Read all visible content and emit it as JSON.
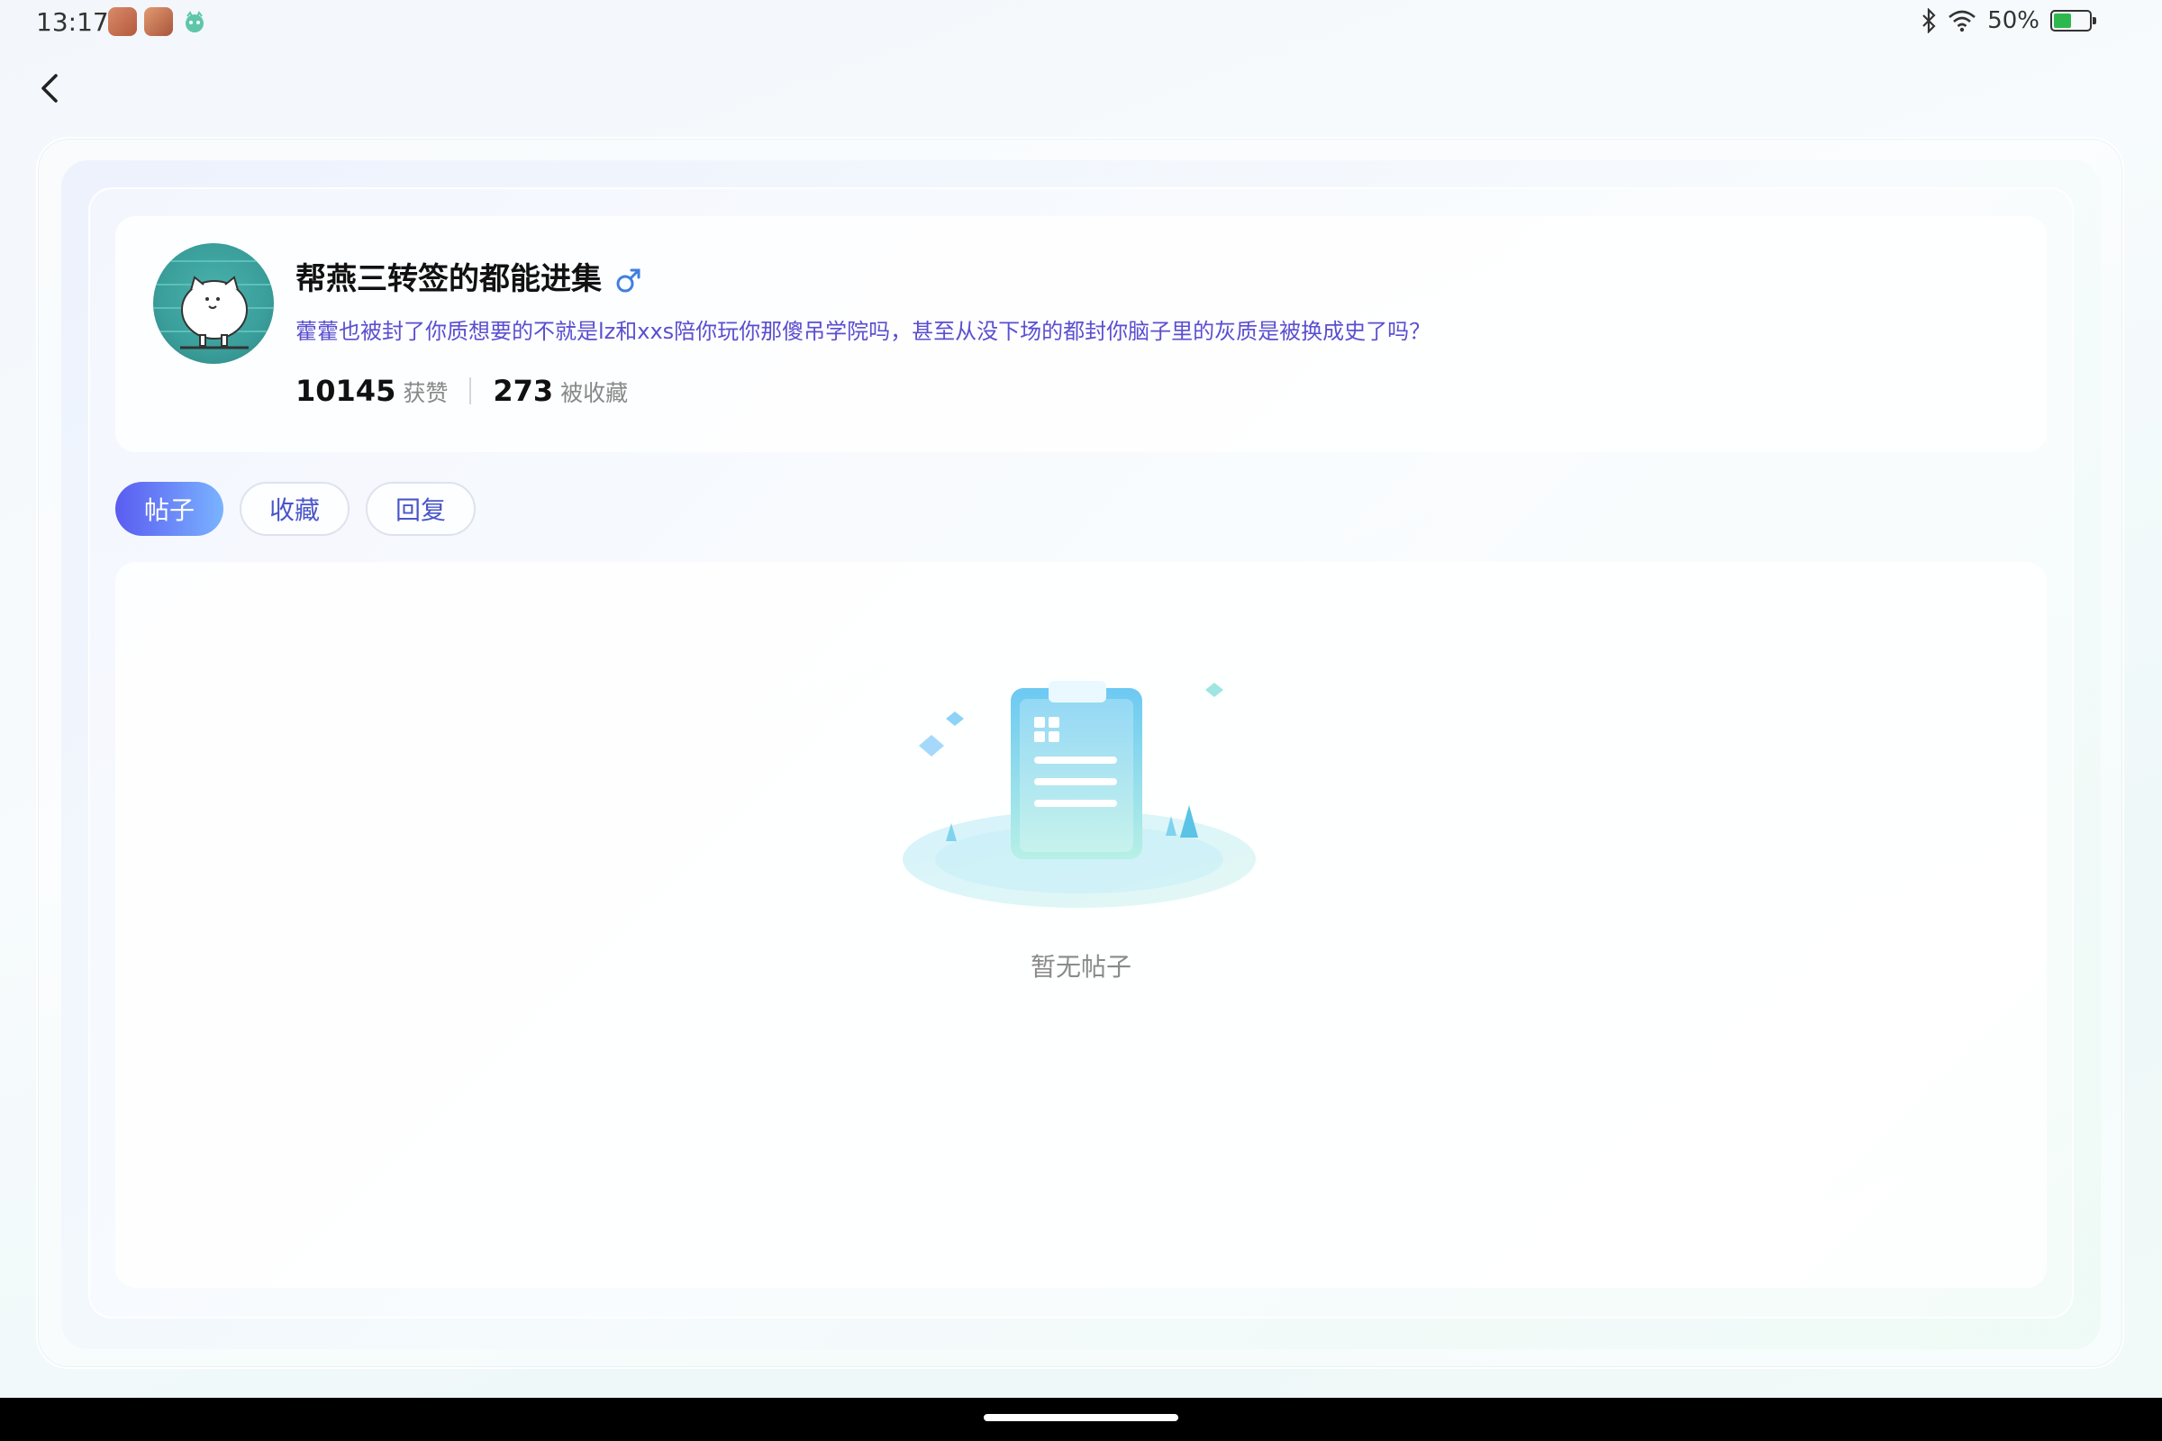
{
  "status_bar": {
    "time": "13:17",
    "battery_percent": "50%",
    "battery_level": 0.5,
    "icons": [
      "bluetooth-icon",
      "wifi-icon",
      "battery-icon"
    ]
  },
  "profile": {
    "username": "帮燕三转签的都能进集",
    "gender_symbol": "♂",
    "bio": "藿藿也被封了你质想要的不就是lz和xxs陪你玩你那傻吊学院吗，甚至从没下场的都封你脑子里的灰质是被换成史了吗？",
    "stats": {
      "likes_value": "10145",
      "likes_label": "获赞",
      "favorites_value": "273",
      "favorites_label": "被收藏"
    }
  },
  "tabs": [
    {
      "label": "帖子",
      "active": true
    },
    {
      "label": "收藏",
      "active": false
    },
    {
      "label": "回复",
      "active": false
    }
  ],
  "empty_state": {
    "text": "暂无帖子",
    "icon": "empty-clipboard-illustration"
  },
  "colors": {
    "accent": "#5a5cf0",
    "bio_text": "#5a4fd0",
    "gender": "#3f7fe0"
  }
}
